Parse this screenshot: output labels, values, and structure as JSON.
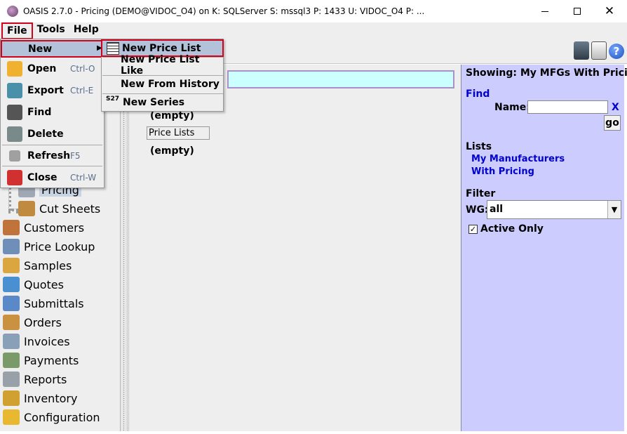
{
  "window": {
    "title": "OASIS 2.7.0 - Pricing (DEMO@VIDOC_O4) on K: SQLServer  S: mssql3  P: 1433  U: VIDOC_O4  P: ...",
    "minimize": "—",
    "close": "✕"
  },
  "menubar": {
    "file": "File",
    "tools": "Tools",
    "help": "Help"
  },
  "toolbar": {
    "help_glyph": "?"
  },
  "file_menu": {
    "new": "New",
    "open": "Open",
    "open_shortcut": "Ctrl-O",
    "export": "Export",
    "export_shortcut": "Ctrl-E",
    "find": "Find",
    "delete": "Delete",
    "refresh": "Refresh",
    "refresh_shortcut": "F5",
    "close": "Close",
    "close_shortcut": "Ctrl-W",
    "submenu_arrow": "▶"
  },
  "new_submenu": {
    "new_price_list": "New Price List",
    "new_price_list_like": "New Price List Like",
    "new_from_history": "New From History",
    "new_series": "New Series",
    "series_icon_text": "S27"
  },
  "nav": {
    "pricing": "Pricing",
    "cut_sheets": "Cut Sheets",
    "items": [
      {
        "label": "Customers",
        "icon": "customers-icon",
        "color": "#c0733a"
      },
      {
        "label": "Price Lookup",
        "icon": "price-lookup-icon",
        "color": "#6f8fb8"
      },
      {
        "label": "Samples",
        "icon": "samples-icon",
        "color": "#d9a640"
      },
      {
        "label": "Quotes",
        "icon": "quotes-icon",
        "color": "#4a8fd0"
      },
      {
        "label": "Submittals",
        "icon": "submittals-icon",
        "color": "#5a88c8"
      },
      {
        "label": "Orders",
        "icon": "orders-icon",
        "color": "#c99240"
      },
      {
        "label": "Invoices",
        "icon": "invoices-icon",
        "color": "#8aa0b8"
      },
      {
        "label": "Payments",
        "icon": "payments-icon",
        "color": "#7a9a6a"
      },
      {
        "label": "Reports",
        "icon": "reports-icon",
        "color": "#9aa0a8"
      },
      {
        "label": "Inventory",
        "icon": "inventory-icon",
        "color": "#d0a030"
      },
      {
        "label": "Configuration",
        "icon": "configuration-icon",
        "color": "#e8b830"
      }
    ]
  },
  "center": {
    "empty_1": "(empty)",
    "price_lists": "Price Lists",
    "empty_2": "(empty)"
  },
  "right_panel": {
    "showing": "Showing: My MFGs With Pricing",
    "find": "Find",
    "name_label": "Name:",
    "name_value": "",
    "clear": "X",
    "go": "go",
    "lists": "Lists",
    "link_my_manufacturers": "My Manufacturers",
    "link_with_pricing": "With Pricing",
    "filter": "Filter",
    "wg_label": "WG:",
    "wg_value": "all",
    "active_only": "Active Only",
    "active_only_checked": true,
    "checkmark": "✓",
    "dropdown_arrow": "▼"
  },
  "colors": {
    "highlight_border": "#d0021b",
    "menu_selected_bg": "#b3c2d8",
    "right_panel_bg": "#ccccff",
    "link": "#0000cc",
    "center_header_bg": "#ccffff"
  }
}
